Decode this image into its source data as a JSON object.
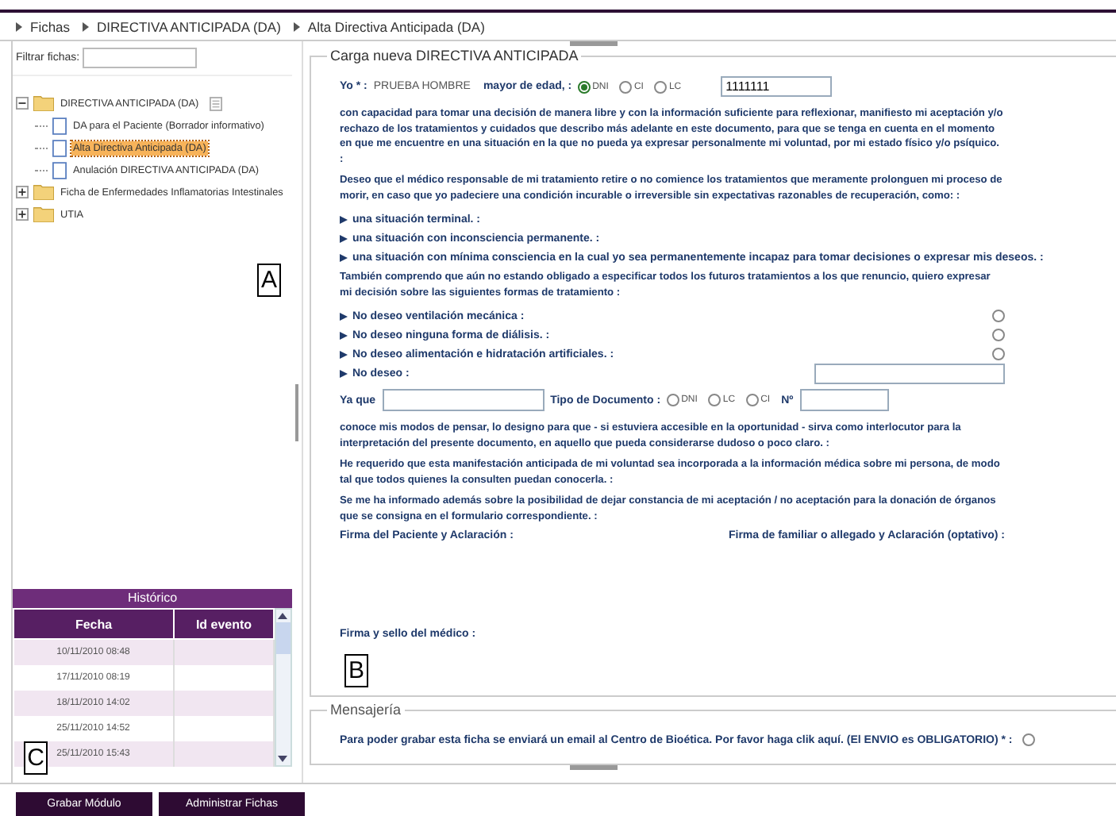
{
  "breadcrumb": [
    "Fichas",
    "DIRECTIVA ANTICIPADA (DA)",
    "Alta Directiva Anticipada (DA)"
  ],
  "filter": {
    "label": "Filtrar fichas:"
  },
  "tree": [
    {
      "label": "DIRECTIVA ANTICIPADA (DA)",
      "expanded": true,
      "selected": false,
      "children": [
        {
          "label": "DA para el Paciente (Borrador informativo)",
          "selected": false
        },
        {
          "label": "Alta Directiva Anticipada (DA)",
          "selected": true
        },
        {
          "label": "Anulación DIRECTIVA ANTICIPADA (DA)",
          "selected": false
        }
      ]
    },
    {
      "label": "Ficha de Enfermedades Inflamatorias Intestinales",
      "expanded": false,
      "selected": false
    },
    {
      "label": "UTIA",
      "expanded": false,
      "selected": false
    }
  ],
  "history": {
    "title": "Histórico",
    "columns": [
      "Fecha",
      "Id evento"
    ],
    "rows": [
      {
        "fecha": "10/11/2010 08:48"
      },
      {
        "fecha": "17/11/2010 08:19"
      },
      {
        "fecha": "18/11/2010 14:02"
      },
      {
        "fecha": "25/11/2010 14:52"
      },
      {
        "fecha": "25/11/2010 15:43"
      }
    ]
  },
  "form": {
    "legend": "Carga nueva DIRECTIVA ANTICIPADA",
    "yo_label": "Yo * :",
    "name": "PRUEBA HOMBRE",
    "age_label": "mayor de edad, :",
    "doc_options": [
      {
        "label": "DNI",
        "selected": true
      },
      {
        "label": "CI",
        "selected": false
      },
      {
        "label": "LC",
        "selected": false
      }
    ],
    "doc_number": "1111111",
    "items": [
      {
        "kind": "text",
        "text": "con capacidad para tomar una decisión de manera libre y con la información suficiente para reflexionar, manifiesto mi aceptación y/o rechazo de los tratamientos y cuidados que describo más adelante en este documento, para que se tenga en cuenta en el momento en que me encuentre en una situación en la que no pueda ya expresar personalmente mi voluntad, por mi estado físico y/o psíquico. :"
      },
      {
        "kind": "text",
        "text": "Deseo que el médico responsable de mi tratamiento retire o no comience los tratamientos que meramente prolonguen mi proceso de morir, en caso que yo padeciere una condición incurable o irreversible sin expectativas razonables de recuperación, como: :"
      },
      {
        "kind": "bullet",
        "text": "una situación terminal. :"
      },
      {
        "kind": "bullet",
        "text": "una situación con inconsciencia permanente. :"
      },
      {
        "kind": "bullet",
        "text": "una situación con mínima consciencia en la cual yo sea permanentemente incapaz para tomar decisiones o expresar mis deseos. :"
      },
      {
        "kind": "text",
        "text": "También comprendo que aún no estando obligado a especificar todos los futuros tratamientos a los que renuncio, quiero expresar mi decisión sobre las siguientes formas de tratamiento :"
      },
      {
        "kind": "option",
        "text": "No deseo ventilación mecánica :",
        "checked": false
      },
      {
        "kind": "option",
        "text": "No deseo ninguna forma de diálisis. :",
        "checked": false
      },
      {
        "kind": "option",
        "text": "No deseo alimentación e hidratación artificiales. :",
        "checked": false
      },
      {
        "kind": "input",
        "text": "No deseo :"
      }
    ]
  },
  "proxy": {
    "label": "Ya que",
    "doc_type_label": "Tipo de Documento :",
    "doc_options": [
      {
        "label": "DNI",
        "selected": false
      },
      {
        "label": "LC",
        "selected": false
      },
      {
        "label": "CI",
        "selected": false
      }
    ],
    "number_label": "Nº"
  },
  "closing": [
    "conoce mis modos de pensar, lo designo para que - si estuviera accesible en la oportunidad - sirva como interlocutor para la interpretación del presente documento, en aquello que pueda considerarse dudoso o poco claro. :",
    "He requerido que esta manifestación anticipada de mi voluntad sea incorporada a la información médica sobre mi persona, de modo tal que todos quienes la consulten puedan conocerla. :",
    "Se me ha informado además sobre la posibilidad de dejar constancia de mi aceptación / no aceptación para la donación de órganos que se consigna en el formulario correspondiente. :"
  ],
  "signatures": {
    "patient": "Firma del Paciente y Aclaración :",
    "relative": "Firma de familiar o allegado y Aclaración (optativo) :",
    "doctor": "Firma y sello del médico :"
  },
  "messaging": {
    "legend": "Mensajería",
    "text": "Para poder grabar esta ficha se enviará un email al Centro de Bioética. Por favor haga clik aquí. (El ENVIO es OBLIGATORIO) * :",
    "checked": false
  },
  "buttons": [
    "Grabar Módulo",
    "Administrar Fichas"
  ],
  "annotations": [
    "A",
    "B",
    "C"
  ]
}
